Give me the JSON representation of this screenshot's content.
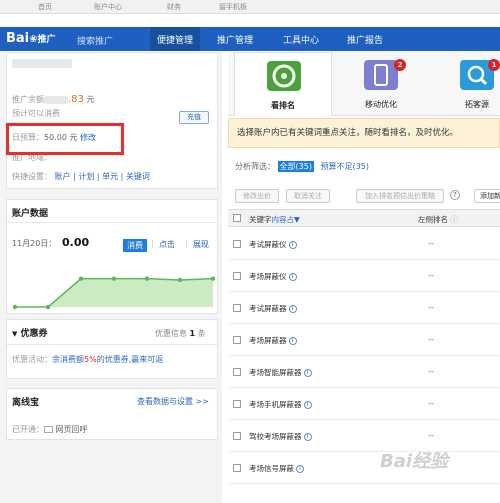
{
  "topbar": {
    "items": [
      "首页",
      "账户中心",
      "财务",
      "留手机板"
    ]
  },
  "nav": {
    "logo": "Bai",
    "logo_sub": "推广",
    "product": "搜索推广",
    "items": [
      "便捷管理",
      "推广管理",
      "工具中心",
      "推广报告"
    ]
  },
  "account": {
    "balance_label": "推广余额",
    "balance_value": ".83",
    "balance_unit": "元",
    "recharge": "充值",
    "estimate": "预计可以消费",
    "budget_label": "日预算：",
    "budget_value": "50.00 元",
    "budget_edit": "修改",
    "region_label": "推广地域：",
    "quick_label": "快捷设置：",
    "quick_links": [
      "账户",
      "计划",
      "单元",
      "关键词"
    ]
  },
  "data": {
    "title": "账户数据",
    "date": "11月20日：",
    "value": "0.00",
    "tabs": [
      "消费",
      "点击",
      "展现"
    ],
    "chart_data": {
      "type": "area",
      "x": [
        1,
        2,
        3,
        4,
        5,
        6,
        7
      ],
      "values": [
        0,
        0,
        0.63,
        0.63,
        0.63,
        0.6,
        0.63
      ],
      "color": "#5cb85c",
      "fill": "#cdebc3"
    }
  },
  "coupon": {
    "title": "优惠券",
    "info_label": "优惠信息",
    "info_count": "1",
    "info_unit": "条",
    "activity_label": "优惠活动：",
    "activity_text": "余消费额",
    "activity_pct": "5%",
    "activity_tail": "的优惠券,赢来可返"
  },
  "lxb": {
    "title": "离线宝",
    "link": "查看数据与设置 >>",
    "opened_label": "已开通：",
    "opened_value": "网页回呼"
  },
  "tools": [
    {
      "label": "看排名",
      "badge": ""
    },
    {
      "label": "移动优化",
      "badge": "2"
    },
    {
      "label": "拓客源",
      "badge": "1"
    }
  ],
  "notice": "选择账户内已有关键词重点关注，随时看排名，及时优化。",
  "filter": {
    "label": "分析筛选：",
    "all": "全部(35)",
    "budget": "预算不足(35)"
  },
  "actions": [
    "修改出价",
    "取消关注",
    "加入排名预估出价策略",
    "添加新关"
  ],
  "help": "?",
  "table": {
    "col_keyword": "关键字",
    "col_content": "内容占",
    "col_rank": "左侧排名",
    "rows": [
      "考试屏蔽仪",
      "考场屏蔽仪",
      "考试屏蔽器",
      "考场屏蔽器",
      "考场智能屏蔽器",
      "考场手机屏蔽器",
      "驾校考场屏蔽器",
      "考场信号屏蔽"
    ]
  },
  "dash": "--",
  "watermark": "Bai经验"
}
